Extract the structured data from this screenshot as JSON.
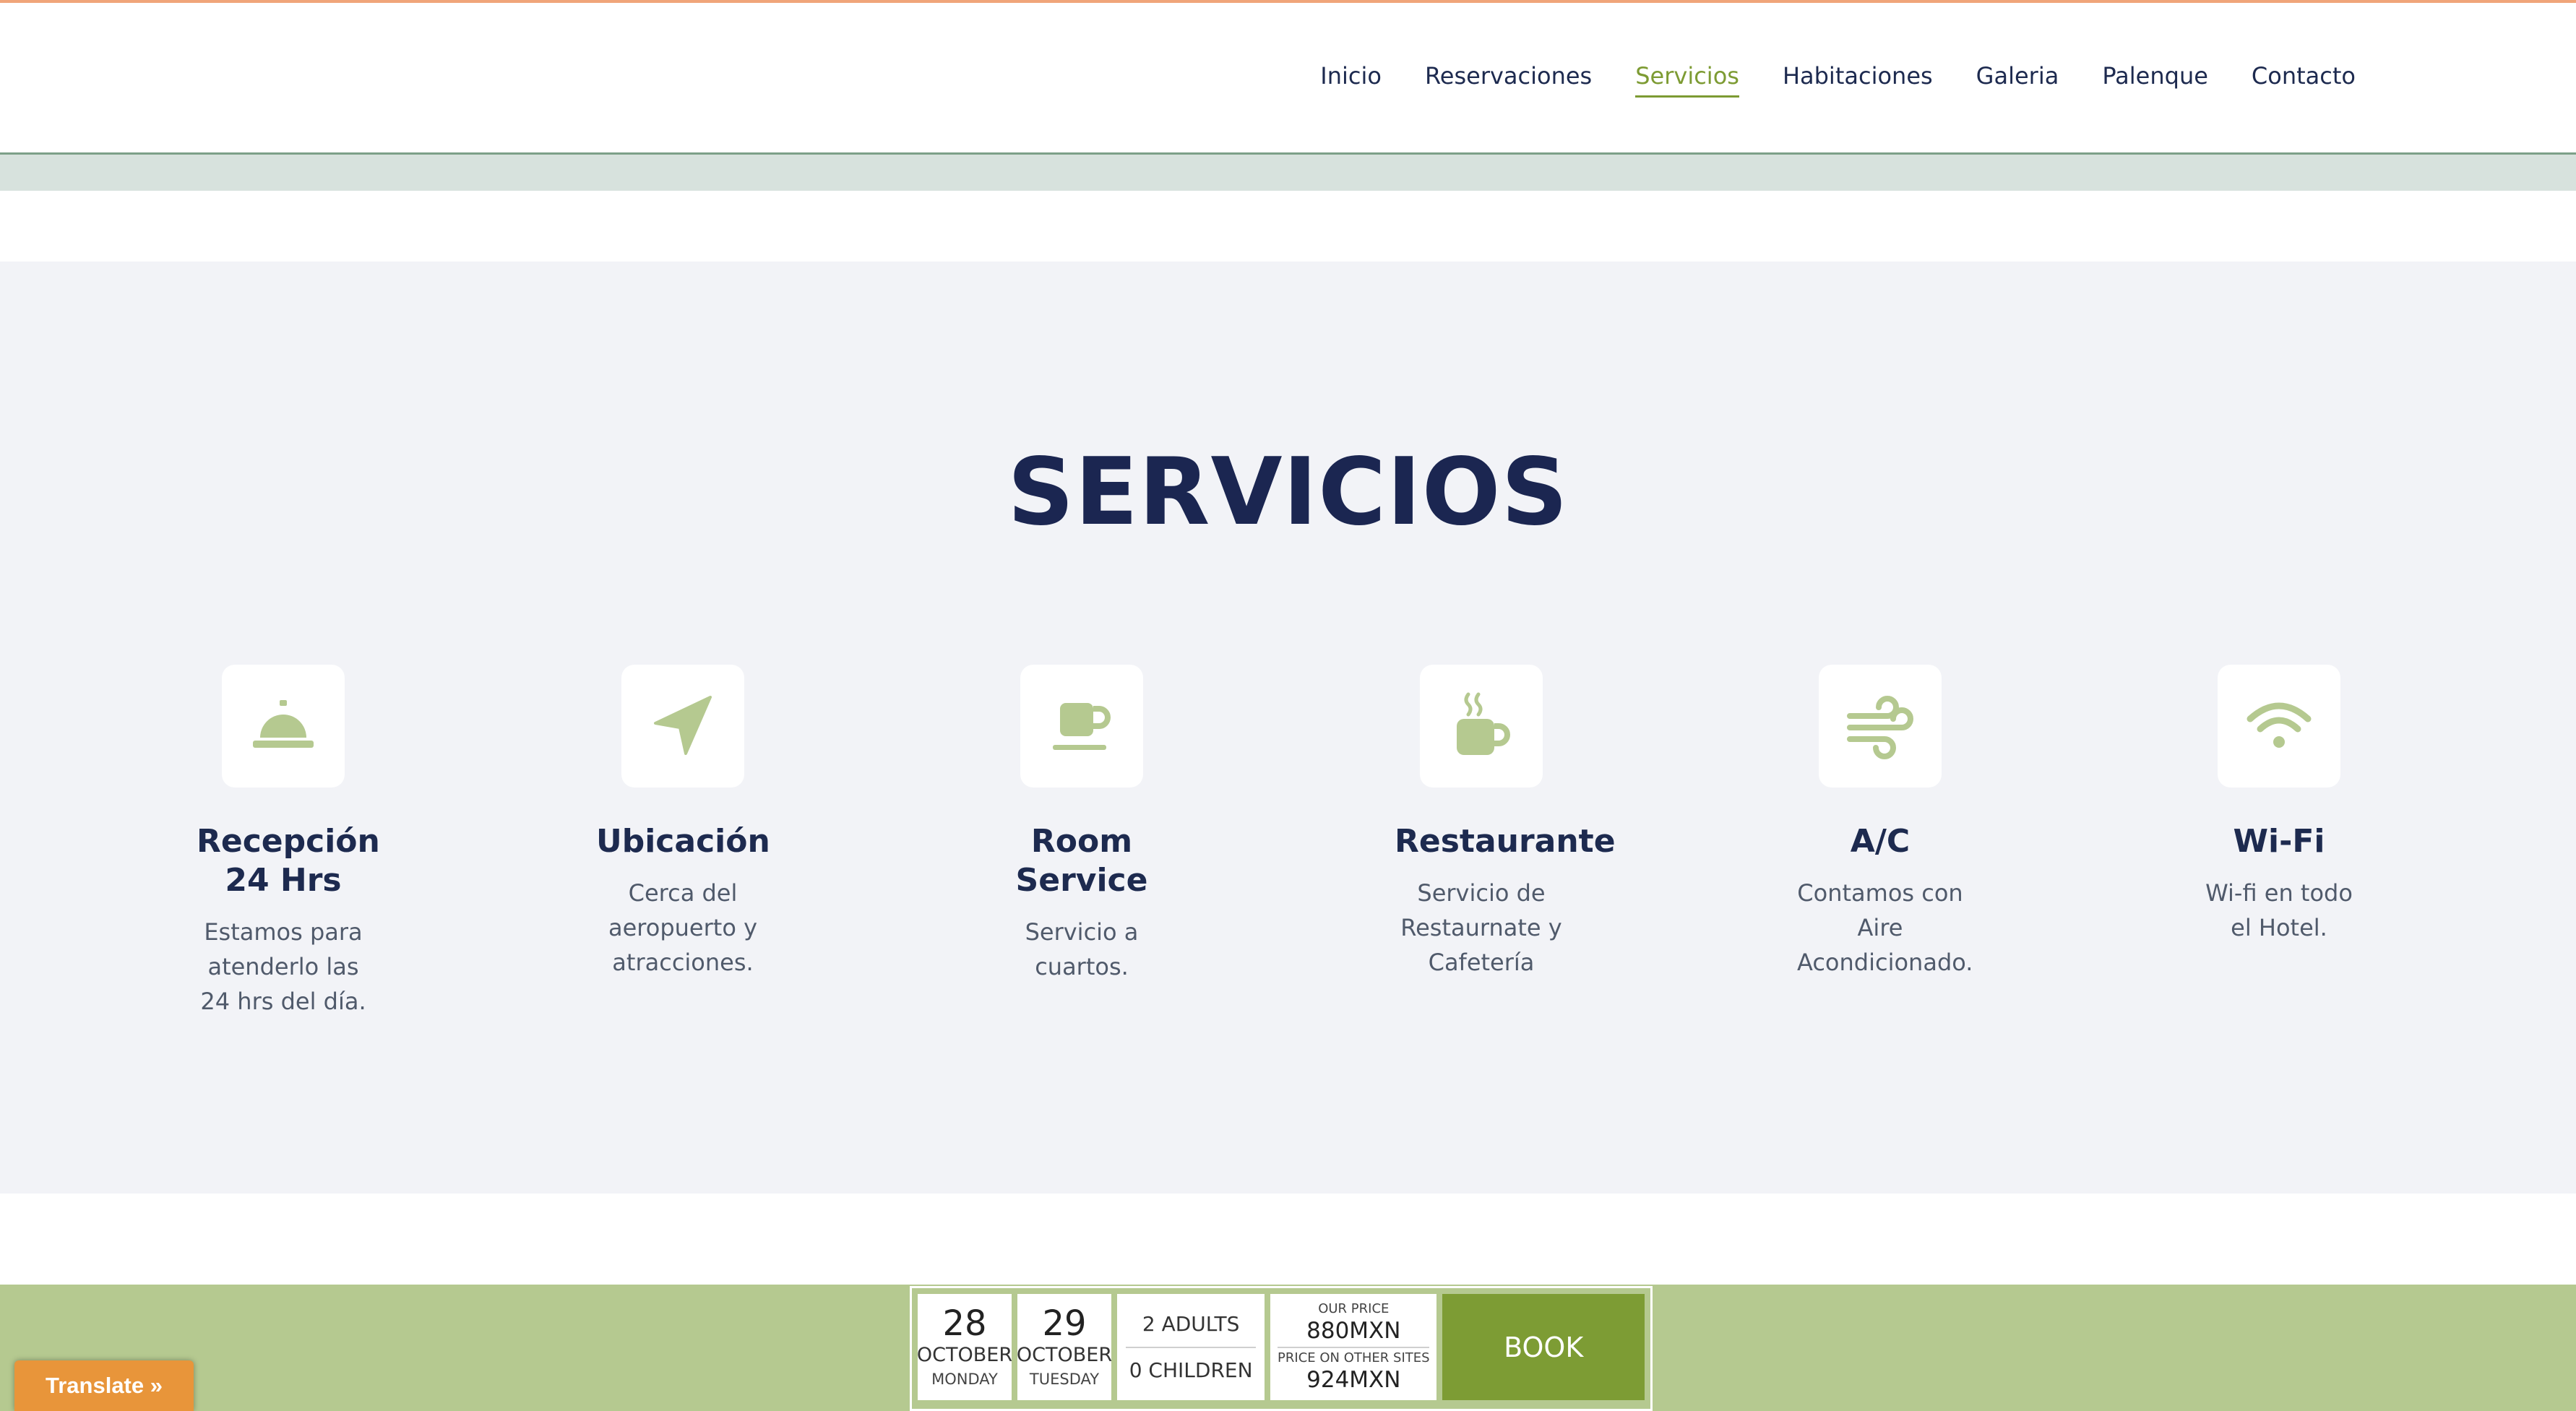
{
  "nav": {
    "items": [
      {
        "label": "Inicio"
      },
      {
        "label": "Reservaciones"
      },
      {
        "label": "Servicios"
      },
      {
        "label": "Habitaciones"
      },
      {
        "label": "Galeria"
      },
      {
        "label": "Palenque"
      },
      {
        "label": "Contacto"
      }
    ],
    "active": "Servicios"
  },
  "services": {
    "title": "SERVICIOS",
    "icon_color": "#b5c990",
    "items": [
      {
        "icon": "concierge-bell-icon",
        "title": "Recepción 24 Hrs",
        "description": "Estamos para atenderlo las 24 hrs del día."
      },
      {
        "icon": "location-arrow-icon",
        "title": "Ubicación",
        "description": "Cerca del aeropuerto y atracciones."
      },
      {
        "icon": "coffee-cup-icon",
        "title": "Room Service",
        "description": "Servicio a cuartos."
      },
      {
        "icon": "hot-mug-icon",
        "title": "Restaurante",
        "description": "Servicio de Restaurnate y Cafetería"
      },
      {
        "icon": "wind-icon",
        "title": "A/C",
        "description": "Contamos con Aire Acondicionado."
      },
      {
        "icon": "wifi-icon",
        "title": "Wi-Fi",
        "description": "Wi-fi en todo el Hotel."
      }
    ]
  },
  "booking": {
    "checkin": {
      "day": "28",
      "month": "OCTOBER",
      "weekday": "MONDAY"
    },
    "checkout": {
      "day": "29",
      "month": "OCTOBER",
      "weekday": "TUESDAY"
    },
    "adults": "2 ADULTS",
    "children": "0 CHILDREN",
    "our_price_label": "OUR PRICE",
    "our_price": "880MXN",
    "other_price_label": "PRICE ON OTHER SITES",
    "other_price": "924MXN",
    "book_label": "BOOK"
  },
  "translate": {
    "label": "Translate »"
  },
  "colors": {
    "accent_green": "#7d9c34",
    "navy": "#1b2651",
    "booking_bar": "#b5c990",
    "translate_orange": "#e8953a"
  }
}
